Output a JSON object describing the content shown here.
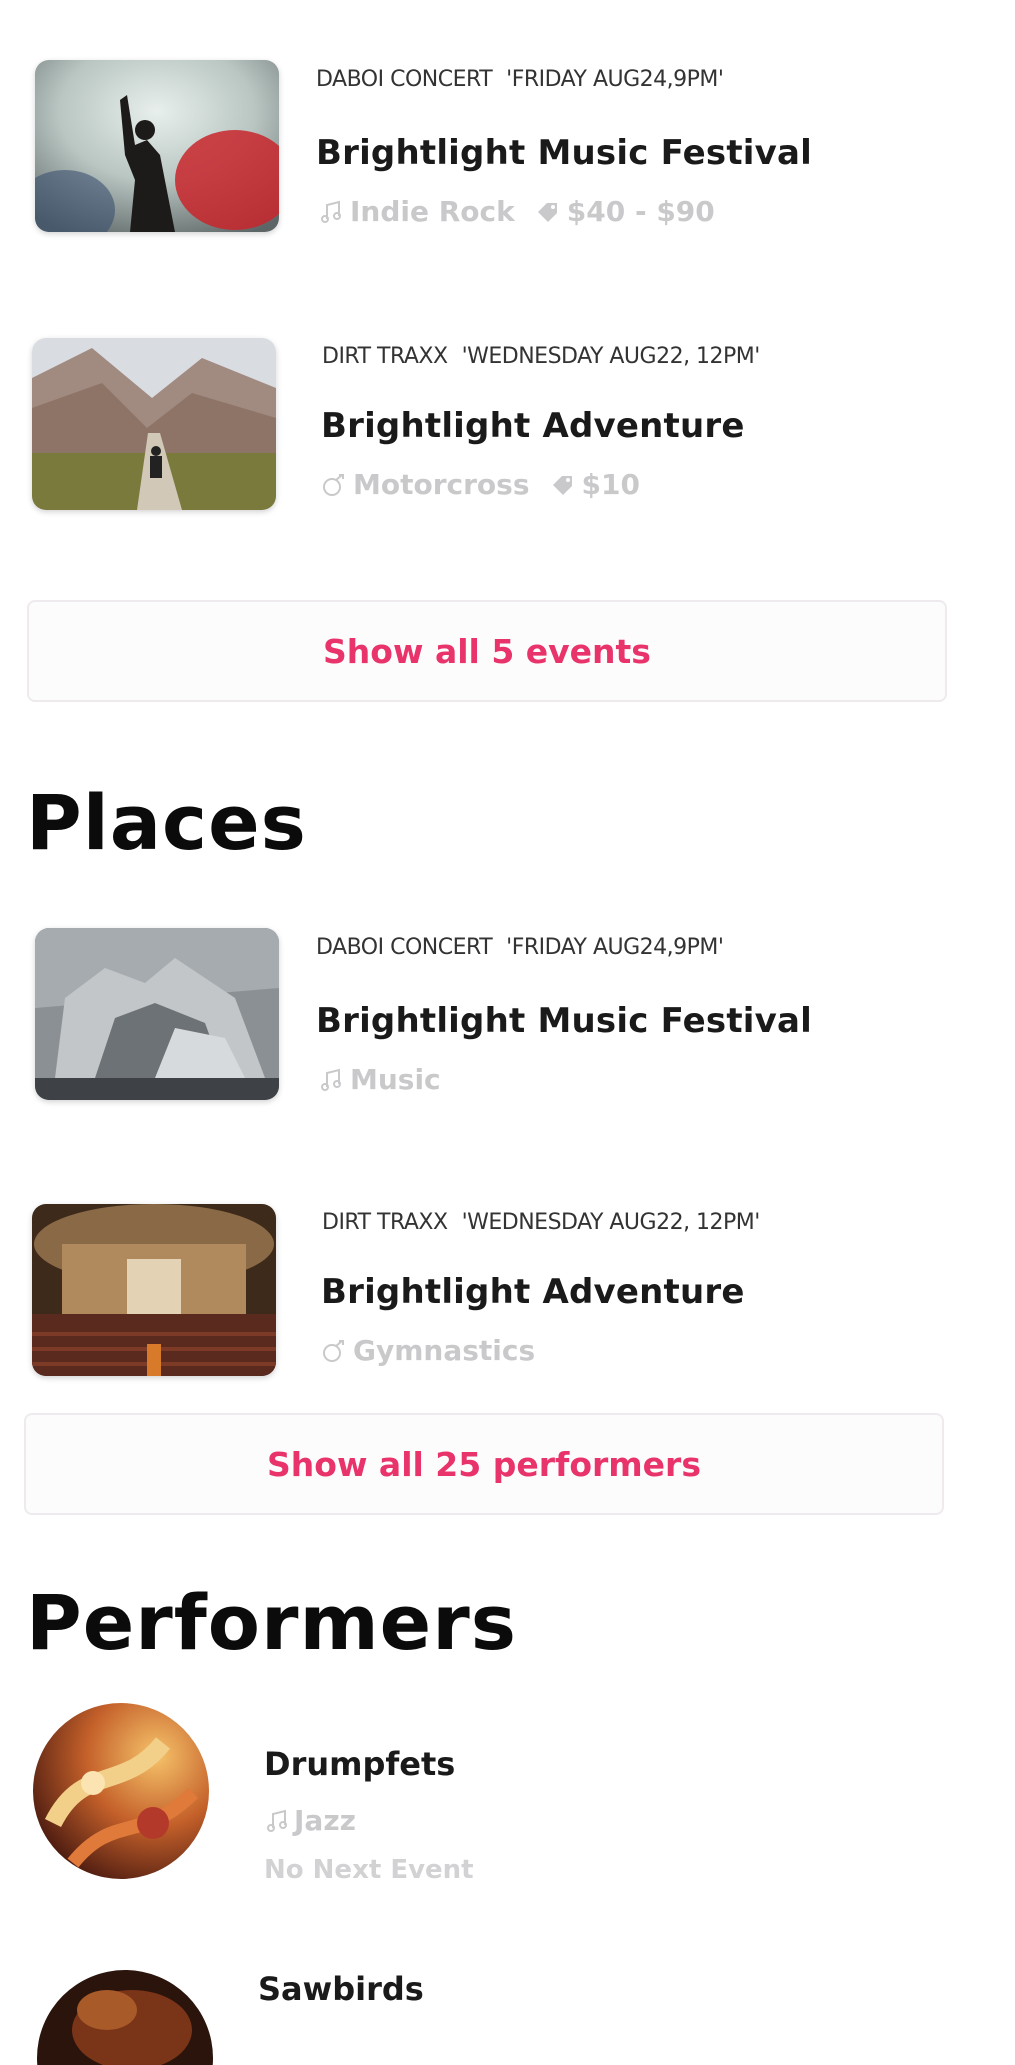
{
  "events": {
    "items": [
      {
        "venue": "DABOI CONCERT",
        "datetime": "'FRIDAY AUG24,9PM'",
        "title": "Brightlight Music Festival",
        "genre_icon": "music-note-icon",
        "genre": "Indie Rock",
        "price_icon": "ticket-icon",
        "price": "$40 - $90"
      },
      {
        "venue": "DIRT TRAXX",
        "datetime": "'WEDNESDAY AUG22, 12PM'",
        "title": "Brightlight Adventure",
        "genre_icon": "sport-icon",
        "genre": "Motorcross",
        "price_icon": "ticket-icon",
        "price": "$10"
      }
    ],
    "show_all_label": "Show all 5 events"
  },
  "places": {
    "heading": "Places",
    "items": [
      {
        "venue": "DABOI CONCERT",
        "datetime": "'FRIDAY AUG24,9PM'",
        "title": "Brightlight Music Festival",
        "genre_icon": "music-note-icon",
        "genre": "Music"
      },
      {
        "venue": "DIRT TRAXX",
        "datetime": "'WEDNESDAY AUG22, 12PM'",
        "title": "Brightlight Adventure",
        "genre_icon": "sport-icon",
        "genre": "Gymnastics"
      }
    ],
    "show_all_label": "Show all 25 performers"
  },
  "performers": {
    "heading": "Performers",
    "items": [
      {
        "name": "Drumpfets",
        "genre_icon": "music-note-icon",
        "genre": "Jazz",
        "next_event": "No Next Event"
      },
      {
        "name": "Sawbirds"
      }
    ]
  },
  "colors": {
    "accent": "#e8336b",
    "muted_text": "#c9c9cc",
    "title_text": "#1a1a1a"
  }
}
